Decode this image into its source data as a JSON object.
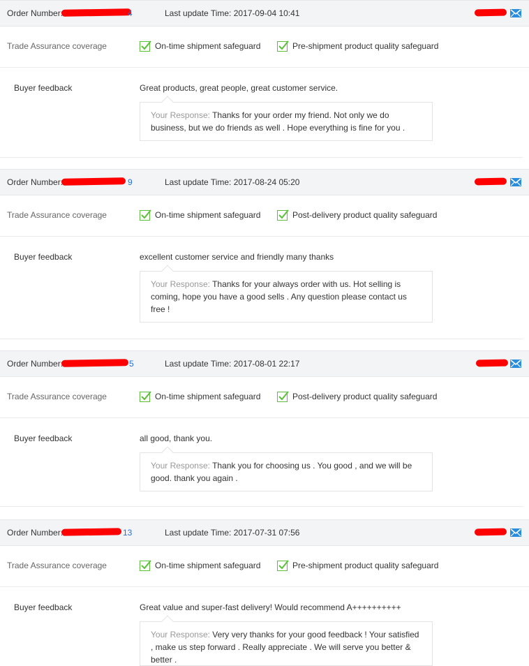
{
  "orders": [
    {
      "order_label": "Order Number:",
      "order_visible_tail": "4",
      "update_label": "Last update Time:",
      "update_time": "2017-09-04 10:41",
      "coverage_label": "Trade Assurance coverage",
      "safeguards": [
        "On-time shipment safeguard",
        "Pre-shipment product quality safeguard"
      ],
      "feedback_label": "Buyer feedback",
      "feedback_text": "Great products, great people, great customer service.",
      "response_label": "Your Response:",
      "response_text": "Thanks for your order my friend. Not only we do business, but we do friends as well . Hope everything is fine for you ."
    },
    {
      "order_label": "Order Number:",
      "order_visible_tail": "9",
      "update_label": "Last update Time:",
      "update_time": "2017-08-24 05:20",
      "coverage_label": "Trade Assurance coverage",
      "safeguards": [
        "On-time shipment safeguard",
        "Post-delivery product quality safeguard"
      ],
      "feedback_label": "Buyer feedback",
      "feedback_text": "excellent customer service and friendly many thanks",
      "response_label": "Your Response:",
      "response_text": "Thanks for your always order with us. Hot selling is coming, hope you have a good sells . Any question please contact us free !"
    },
    {
      "order_label": "Order Number:",
      "order_visible_tail": "5",
      "update_label": "Last update Time:",
      "update_time": "2017-08-01 22:17",
      "coverage_label": "Trade Assurance coverage",
      "safeguards": [
        "On-time shipment safeguard",
        "Post-delivery product quality safeguard"
      ],
      "feedback_label": "Buyer feedback",
      "feedback_text": "all good, thank you.",
      "response_label": "Your Response:",
      "response_text": "Thank you for choosing us . You good , and we will be good. thank you again ."
    },
    {
      "order_label": "Order Number:",
      "order_visible_tail": "13",
      "update_label": "Last update Time:",
      "update_time": "2017-07-31 07:56",
      "coverage_label": "Trade Assurance coverage",
      "safeguards": [
        "On-time shipment safeguard",
        "Pre-shipment product quality safeguard"
      ],
      "feedback_label": "Buyer feedback",
      "feedback_text": "Great value and super-fast delivery! Would recommend A++++++++++",
      "response_label": "Your Response:",
      "response_text": "Very very thanks for your good feedback ! Your satisfied , make us step forward . Really appreciate . We will serve you better & better ."
    }
  ],
  "colors": {
    "header_bg": "#f3f4f6",
    "check_green": "#5cbf3a",
    "mail_blue": "#2a8cdc",
    "redaction": "#ff0000",
    "link_blue": "#2a6fd6"
  },
  "icons": {
    "check": "check-icon",
    "mail": "mail-icon"
  }
}
